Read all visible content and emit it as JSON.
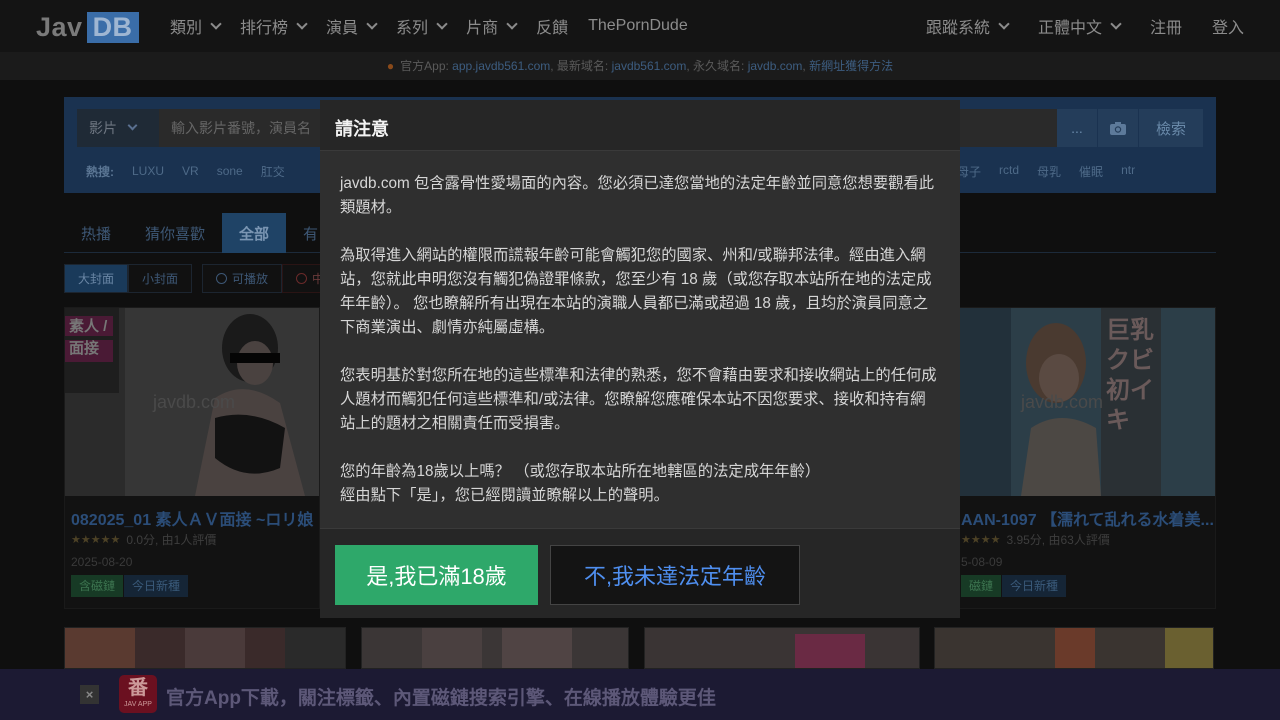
{
  "nav": {
    "logo_left": "Jav",
    "logo_right": "DB",
    "items": [
      {
        "label": "類別",
        "dropdown": true
      },
      {
        "label": "排行榜",
        "dropdown": true
      },
      {
        "label": "演員",
        "dropdown": true
      },
      {
        "label": "系列",
        "dropdown": true
      },
      {
        "label": "片商",
        "dropdown": true
      },
      {
        "label": "反饋",
        "dropdown": false
      },
      {
        "label": "ThePornDude",
        "dropdown": false
      }
    ],
    "right_items": [
      {
        "label": "跟蹤系統",
        "dropdown": true
      },
      {
        "label": "正體中文",
        "dropdown": true
      },
      {
        "label": "注冊",
        "dropdown": false
      },
      {
        "label": "登入",
        "dropdown": false
      }
    ]
  },
  "announcement": {
    "prefix": "官方App:",
    "app_domain": "app.javdb561.com",
    "latest_label": ", 最新域名:",
    "latest_domain": "javdb561.com",
    "permanent_label": ", 永久域名:",
    "permanent_domain": "javdb.com",
    "sep": ",",
    "new_domain_link": "新網址獲得方法"
  },
  "search": {
    "type_label": "影片",
    "placeholder": "輸入影片番號，演員名",
    "more_label": "...",
    "search_label": "檢索",
    "hot_label": "熱搜:",
    "hot_tags": [
      "LUXU",
      "VR",
      "sone",
      "肛交"
    ],
    "hot_tags_right": [
      "母子",
      "rctd",
      "母乳",
      "催眠",
      "ntr"
    ]
  },
  "tabs": [
    "热播",
    "猜你喜歡",
    "全部",
    "有"
  ],
  "filters": {
    "big_cover": "大封面",
    "small_cover": "小封面",
    "playable": "可播放",
    "chinese": "中字"
  },
  "cards": [
    {
      "title": "082025_01 素人ＡＶ面接 ~ロリ娘",
      "score": "0.0分, 由1人評價",
      "date": "2025-08-20",
      "tag1": "含磁鏈",
      "tag2": "今日新種",
      "watermark": "javdb.com",
      "cover_text": "素人 /面接"
    },
    {
      "title": "AAN-1097 【濡れて乱れる水着美...",
      "score": "3.95分, 由63人評價",
      "date": "5-08-09",
      "tag1": "磁鏈",
      "tag2": "今日新種",
      "watermark": "javdb.com",
      "cover_text": "巨乳 クビ 初イキ"
    }
  ],
  "banner": {
    "close": "×",
    "logo_big": "番",
    "logo_small": "JAV APP",
    "text": "官方App下載，關注標籤、內置磁鏈搜索引擎、在線播放體驗更佳"
  },
  "modal": {
    "title": "請注意",
    "p1": "javdb.com 包含露骨性愛場面的內容。您必須已達您當地的法定年齡並同意您想要觀看此類題材。",
    "p2": "為取得進入網站的權限而謊報年齡可能會觸犯您的國家、州和/或聯邦法律。經由進入網站，您就此申明您沒有觸犯偽證罪條款，您至少有 18 歲（或您存取本站所在地的法定成年年齡）。 您也瞭解所有出現在本站的演職人員都已滿或超過 18 歲，且均於演員同意之下商業演出、劇情亦純屬虛構。",
    "p3": "您表明基於對您所在地的這些標準和法律的熟悉，您不會藉由要求和接收網站上的任何成人題材而觸犯任何這些標準和/或法律。您瞭解您應確保本站不因您要求、接收和持有網站上的題材之相關責任而受損害。",
    "p4a": "您的年齡為18歲以上嗎？ （或您存取本站所在地轄區的法定成年年齡）",
    "p4b": "經由點下「是」，您已經閱讀並瞭解以上的聲明。",
    "yes_label": "是,我已滿18歲",
    "no_label": "不,我未達法定年齡"
  }
}
